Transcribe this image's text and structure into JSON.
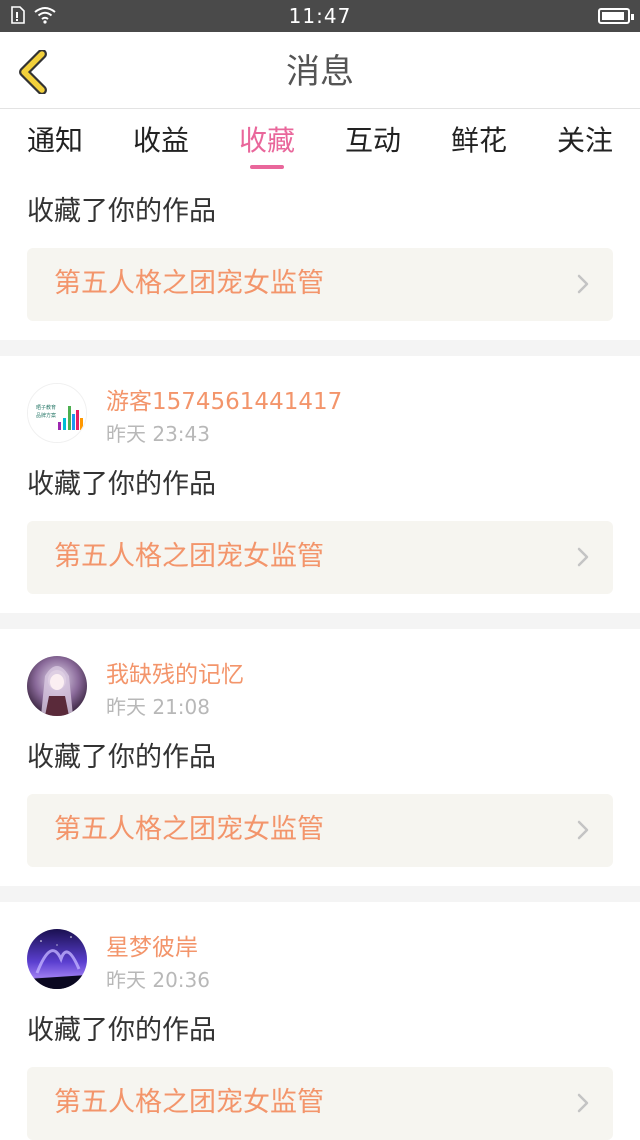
{
  "status_bar": {
    "time": "11:47"
  },
  "header": {
    "title": "消息"
  },
  "tabs": [
    {
      "label": "通知",
      "active": false
    },
    {
      "label": "收益",
      "active": false
    },
    {
      "label": "收藏",
      "active": true
    },
    {
      "label": "互动",
      "active": false
    },
    {
      "label": "鲜花",
      "active": false
    },
    {
      "label": "关注",
      "active": false
    }
  ],
  "colors": {
    "accent": "#e9679b",
    "link": "#f3956b",
    "card_bg": "#f6f5f0",
    "separator": "#f4f4f4",
    "back_icon": "#f2d03b"
  },
  "messages": [
    {
      "action": "收藏了你的作品",
      "work_title": "第五人格之团宠女监管"
    },
    {
      "user": "游客1574561441417",
      "time": "昨天 23:43",
      "action": "收藏了你的作品",
      "work_title": "第五人格之团宠女监管",
      "avatar_text": [
        "晒子教育",
        "品牌方案"
      ]
    },
    {
      "user": "我缺残的记忆",
      "time": "昨天 21:08",
      "action": "收藏了你的作品",
      "work_title": "第五人格之团宠女监管"
    },
    {
      "user": "星梦彼岸",
      "time": "昨天 20:36",
      "action": "收藏了你的作品",
      "work_title": "第五人格之团宠女监管"
    }
  ]
}
